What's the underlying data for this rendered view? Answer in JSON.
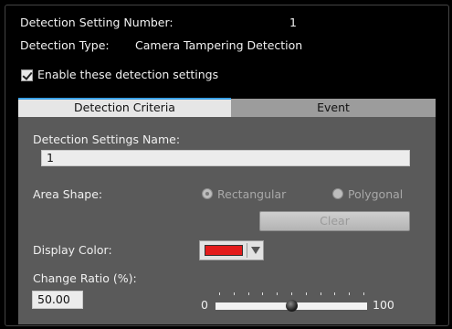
{
  "header": {
    "setting_number_label": "Detection Setting Number:",
    "setting_number_value": "1",
    "detection_type_label": "Detection Type:",
    "detection_type_value": "Camera Tampering Detection",
    "enable_label": "Enable these detection settings",
    "enable_checked": true
  },
  "tabs": [
    {
      "label": "Detection Criteria",
      "active": true
    },
    {
      "label": "Event",
      "active": false
    }
  ],
  "criteria": {
    "name_label": "Detection Settings Name:",
    "name_value": "1",
    "area_shape_label": "Area Shape:",
    "area_shape_options": [
      "Rectangular",
      "Polygonal"
    ],
    "area_shape_selected": "Rectangular",
    "clear_label": "Clear",
    "display_color_label": "Display Color:",
    "display_color_value": "#e31b1b",
    "change_ratio_label": "Change Ratio (%):",
    "change_ratio_value": "50.00",
    "slider_min": "0",
    "slider_max": "100",
    "slider_level": 0.5
  },
  "colors": {
    "accent": "#3aa0e6",
    "panel": "#5a5a5a",
    "background": "#000000"
  }
}
